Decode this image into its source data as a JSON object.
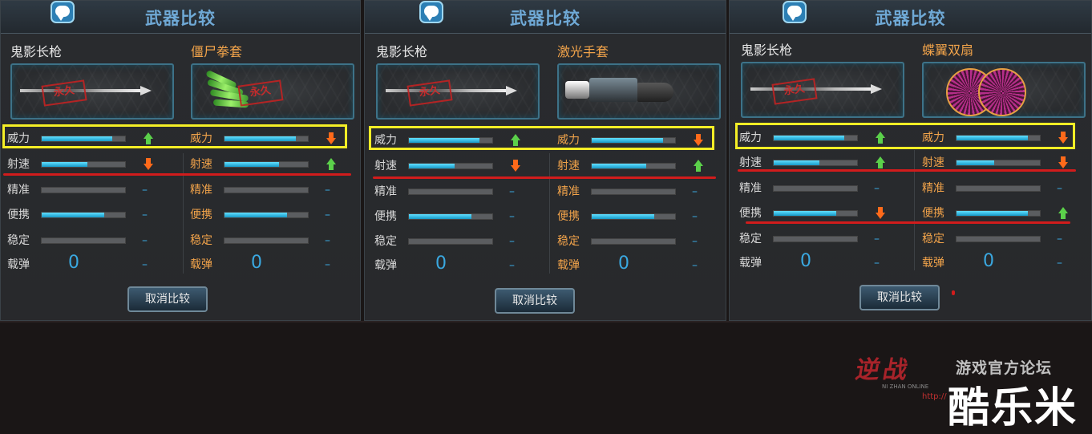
{
  "panels": [
    {
      "title": "武器比较",
      "left": {
        "name": "鬼影长枪",
        "stamp": "永久"
      },
      "right": {
        "name": "僵尸拳套",
        "stamp": "永久"
      },
      "stats_left": [
        {
          "label": "威力",
          "fill": 0.85,
          "indicator": "up"
        },
        {
          "label": "射速",
          "fill": 0.55,
          "indicator": "down"
        },
        {
          "label": "精准",
          "fill": 0,
          "indicator": "dash"
        },
        {
          "label": "便携",
          "fill": 0.75,
          "indicator": "dash"
        },
        {
          "label": "稳定",
          "fill": 0,
          "indicator": "dash"
        }
      ],
      "stats_right": [
        {
          "label": "威力",
          "fill": 0.86,
          "indicator": "down"
        },
        {
          "label": "射速",
          "fill": 0.65,
          "indicator": "up"
        },
        {
          "label": "精准",
          "fill": 0,
          "indicator": "dash"
        },
        {
          "label": "便携",
          "fill": 0.75,
          "indicator": "dash"
        },
        {
          "label": "稳定",
          "fill": 0,
          "indicator": "dash"
        }
      ],
      "ammo_label": "载弹",
      "ammo_left": "0",
      "ammo_right": "0",
      "ammo_dash": "–",
      "cancel_button": "取消比较"
    },
    {
      "title": "武器比较",
      "left": {
        "name": "鬼影长枪",
        "stamp": "永久"
      },
      "right": {
        "name": "激光手套"
      },
      "stats_left": [
        {
          "label": "威力",
          "fill": 0.85,
          "indicator": "up"
        },
        {
          "label": "射速",
          "fill": 0.55,
          "indicator": "down"
        },
        {
          "label": "精准",
          "fill": 0,
          "indicator": "dash"
        },
        {
          "label": "便携",
          "fill": 0.75,
          "indicator": "dash"
        },
        {
          "label": "稳定",
          "fill": 0,
          "indicator": "dash"
        }
      ],
      "stats_right": [
        {
          "label": "威力",
          "fill": 0.86,
          "indicator": "down"
        },
        {
          "label": "射速",
          "fill": 0.65,
          "indicator": "up"
        },
        {
          "label": "精准",
          "fill": 0,
          "indicator": "dash"
        },
        {
          "label": "便携",
          "fill": 0.75,
          "indicator": "dash"
        },
        {
          "label": "稳定",
          "fill": 0,
          "indicator": "dash"
        }
      ],
      "ammo_label": "载弹",
      "ammo_left": "0",
      "ammo_right": "0",
      "ammo_dash": "–",
      "cancel_button": "取消比较"
    },
    {
      "title": "武器比较",
      "left": {
        "name": "鬼影长枪",
        "stamp": "永久"
      },
      "right": {
        "name": "蝶翼双扇"
      },
      "stats_left": [
        {
          "label": "威力",
          "fill": 0.85,
          "indicator": "up"
        },
        {
          "label": "射速",
          "fill": 0.55,
          "indicator": "up"
        },
        {
          "label": "精准",
          "fill": 0,
          "indicator": "dash"
        },
        {
          "label": "便携",
          "fill": 0.75,
          "indicator": "down"
        },
        {
          "label": "稳定",
          "fill": 0,
          "indicator": "dash"
        }
      ],
      "stats_right": [
        {
          "label": "威力",
          "fill": 0.86,
          "indicator": "down"
        },
        {
          "label": "射速",
          "fill": 0.45,
          "indicator": "down"
        },
        {
          "label": "精准",
          "fill": 0,
          "indicator": "dash"
        },
        {
          "label": "便携",
          "fill": 0.86,
          "indicator": "up"
        },
        {
          "label": "稳定",
          "fill": 0,
          "indicator": "dash"
        }
      ],
      "ammo_label": "载弹",
      "ammo_left": "0",
      "ammo_right": "0",
      "ammo_dash": "–",
      "cancel_button": "取消比较"
    }
  ],
  "watermark": {
    "logo": "逆战",
    "logo_sub": "NI ZHAN ONLINE",
    "forum": "游戏官方论坛",
    "url": "http://",
    "site": "酷乐米"
  },
  "colors": {
    "highlight_box": "#f4ee26",
    "underline": "#d11c1c",
    "bar_fill": "#1ab2e0",
    "arrow_up": "#5bd04a",
    "arrow_down": "#ff6a1a"
  }
}
